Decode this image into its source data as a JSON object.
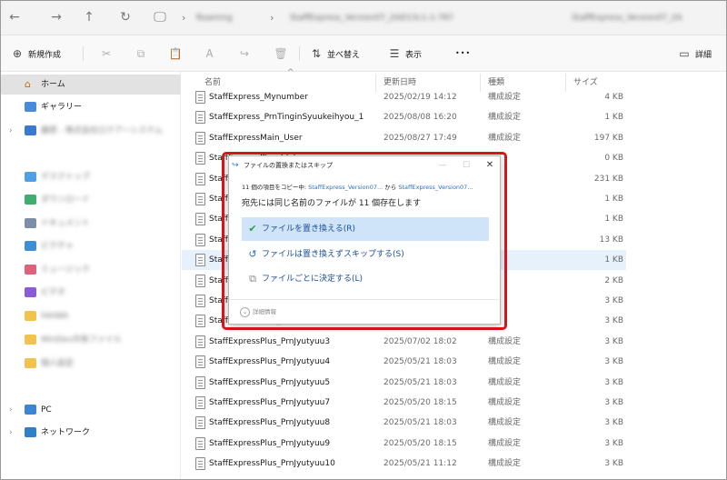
{
  "addressbar": {
    "back_icon": "←",
    "forward_icon": "→",
    "up_icon": "↑",
    "refresh_icon": "↻",
    "pc_icon": "🖵",
    "sep": "›",
    "path": [
      "Roaming",
      "StaffExpress_Version07_2AD13c1-1-787"
    ],
    "search_text": "StaffExpress_Version07_2A"
  },
  "toolbar": {
    "new_label": "新規作成",
    "sort_label": "並べ替え",
    "view_label": "表示",
    "more_label": "•••",
    "details_label": "詳細",
    "icons": {
      "new": "⊕",
      "cut": "✂",
      "copy": "⧉",
      "paste": "📋",
      "rename": "Ꭺ",
      "share": "↪",
      "delete": "🗑",
      "sort": "⇅",
      "view": "☰",
      "details": "▭"
    }
  },
  "sidebar": {
    "home": "ホーム",
    "gallery": "ギャラリー",
    "onedrive": "藤原 - 株式会社ロクアーシステム",
    "quick": [
      "デスクトップ",
      "ダウンロード",
      "ドキュメント",
      "ピクチャ",
      "ミュージック",
      "ビデオ",
      "HAIWA",
      "WinDev共有ファイル",
      "個人設定"
    ],
    "pc": "PC",
    "network": "ネットワーク"
  },
  "list": {
    "columns": {
      "name": "名前",
      "date": "更新日時",
      "type": "種類",
      "size": "サイズ"
    },
    "sort_indicator": "^",
    "rows": [
      {
        "name": "StaffExpress_Mynumber",
        "date": "2025/02/19 14:12",
        "type": "構成設定",
        "size": "4 KB"
      },
      {
        "name": "StaffExpress_PrnTinginSyuukeihyou_1",
        "date": "2025/08/08 16:20",
        "type": "構成設定",
        "size": "1 KB"
      },
      {
        "name": "StaffExpressMain_User",
        "date": "2025/08/27 17:49",
        "type": "構成設定",
        "size": "197 KB"
      },
      {
        "name": "StaffExpressPlus_Jdata",
        "date": "",
        "type": "",
        "size": "0 KB"
      },
      {
        "name": "StaffExpressPlus_Mail",
        "date": "",
        "type": "",
        "size": "231 KB"
      },
      {
        "name": "StaffExpressPlus_Mynumber",
        "date": "",
        "type": "",
        "size": "1 KB"
      },
      {
        "name": "StaffExpressPlus_NewSearch",
        "date": "",
        "type": "",
        "size": "1 KB"
      },
      {
        "name": "StaffExpressPlus_Prn",
        "date": "",
        "type": "",
        "size": "13 KB"
      },
      {
        "name": "StaffExpressPlus_Prn2",
        "date": "",
        "type": "",
        "size": "1 KB"
      },
      {
        "name": "StaffExpressPlus_PrnIrai",
        "date": "",
        "type": "",
        "size": "2 KB"
      },
      {
        "name": "StaffExpressPlus_PrnJyutyuu",
        "date": "",
        "type": "",
        "size": "3 KB"
      },
      {
        "name": "StaffExpressPlus_PrnJyutyuu2",
        "date": "",
        "type": "",
        "size": "3 KB"
      },
      {
        "name": "StaffExpressPlus_PrnJyutyuu3",
        "date": "2025/07/02 18:02",
        "type": "構成設定",
        "size": "3 KB"
      },
      {
        "name": "StaffExpressPlus_PrnJyutyuu4",
        "date": "2025/05/21 18:03",
        "type": "構成設定",
        "size": "3 KB"
      },
      {
        "name": "StaffExpressPlus_PrnJyutyuu5",
        "date": "2025/05/21 18:03",
        "type": "構成設定",
        "size": "3 KB"
      },
      {
        "name": "StaffExpressPlus_PrnJyutyuu7",
        "date": "2025/05/20 18:15",
        "type": "構成設定",
        "size": "3 KB"
      },
      {
        "name": "StaffExpressPlus_PrnJyutyuu8",
        "date": "2025/05/21 18:03",
        "type": "構成設定",
        "size": "3 KB"
      },
      {
        "name": "StaffExpressPlus_PrnJyutyuu9",
        "date": "2025/05/20 18:15",
        "type": "構成設定",
        "size": "3 KB"
      },
      {
        "name": "StaffExpressPlus_PrnJyutyuu10",
        "date": "2025/05/21 11:12",
        "type": "構成設定",
        "size": "3 KB"
      }
    ]
  },
  "dialog": {
    "title": "ファイルの置換またはスキップ",
    "title_icon": "↪",
    "minimize": "—",
    "maximize": "☐",
    "close": "✕",
    "from_text_1": "11 個の項目をコピー中: ",
    "from_src": "StaffExpress_Version07...",
    "from_text_2": " から ",
    "from_dst": "StaffExpress_Version07...",
    "headline": "宛先には同じ名前のファイルが 11 個存在します",
    "options": [
      {
        "icon": "✔",
        "label": "ファイルを置き換える(R)"
      },
      {
        "icon": "↺",
        "label": "ファイルは置き換えずスキップする(S)"
      },
      {
        "icon": "⧉",
        "label": "ファイルごとに決定する(L)"
      }
    ],
    "details_icon": "⌄",
    "details_label": "詳細情報"
  },
  "colors": {
    "highlight_red": "#e0141b",
    "option_selected_bg": "#cfe4f9",
    "link_blue": "#2a6fc4",
    "row_hover": "#e6f1fb"
  }
}
